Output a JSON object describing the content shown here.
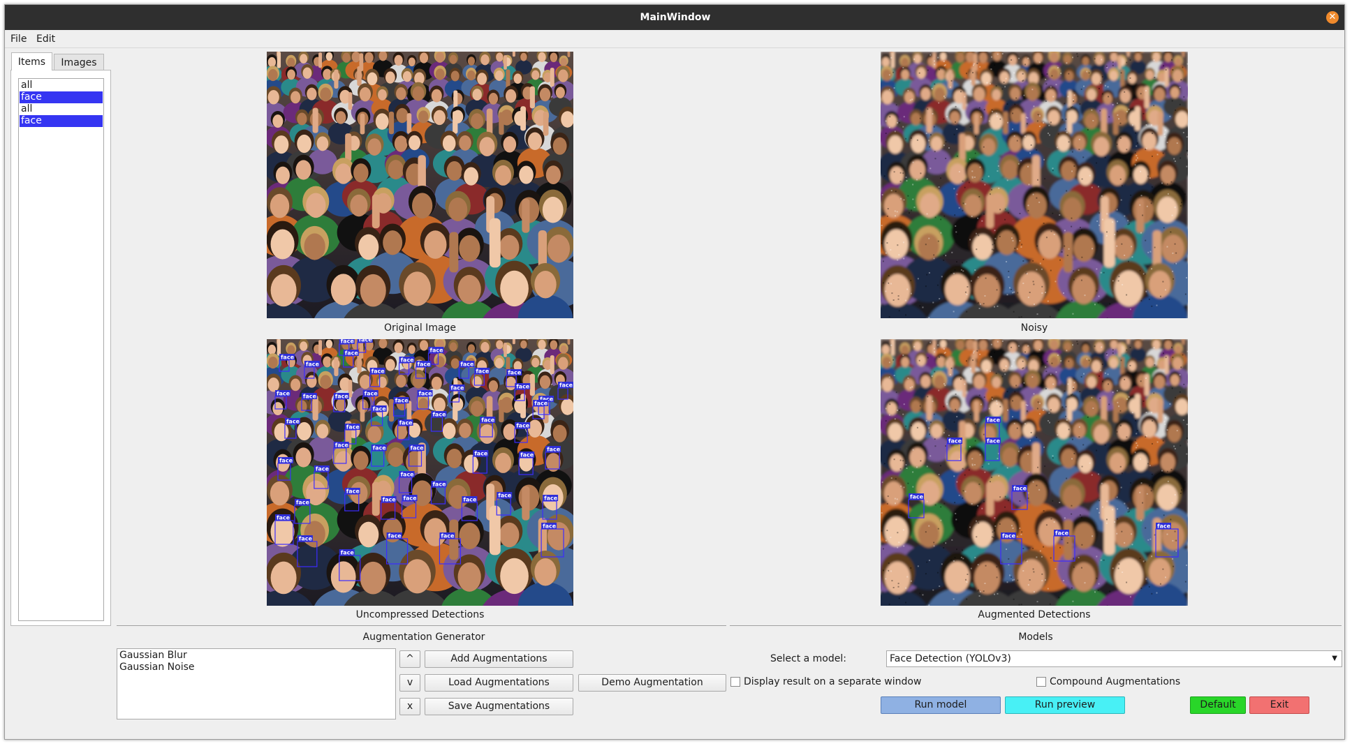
{
  "window": {
    "title": "MainWindow",
    "close_icon": "close-icon"
  },
  "menu": [
    "File",
    "Edit"
  ],
  "tabs": [
    {
      "label": "Items",
      "active": true
    },
    {
      "label": "Images",
      "active": false
    }
  ],
  "items_list": [
    {
      "label": "all",
      "selected": false
    },
    {
      "label": "face",
      "selected": true
    },
    {
      "label": "all",
      "selected": false
    },
    {
      "label": "face",
      "selected": true
    }
  ],
  "panels": {
    "original": "Original Image",
    "noisy": "Noisy",
    "uncompressed": "Uncompressed Detections",
    "augmented": "Augmented Detections"
  },
  "detection_label": "face",
  "augmentation": {
    "title": "Augmentation Generator",
    "list": [
      "Gaussian Blur",
      "Gaussian Noise"
    ],
    "up_label": "^",
    "down_label": "v",
    "remove_label": "x",
    "add_label": "Add Augmentations",
    "load_label": "Load Augmentations",
    "save_label": "Save Augmentations",
    "demo_label": "Demo Augmentation"
  },
  "models": {
    "title": "Models",
    "select_label": "Select a model:",
    "selected_model": "Face Detection (YOLOv3)",
    "display_separate_label": "Display result on a separate window",
    "display_separate_checked": false,
    "compound_label": "Compound Augmentations",
    "compound_checked": false,
    "run_model_label": "Run model",
    "run_preview_label": "Run preview",
    "default_label": "Default",
    "exit_label": "Exit"
  },
  "colors": {
    "selection": "#3535f2",
    "run_model": "#8fb1e3",
    "run_preview": "#48f0f5",
    "default": "#29d629",
    "exit": "#f27171",
    "close": "#f08a2c"
  }
}
